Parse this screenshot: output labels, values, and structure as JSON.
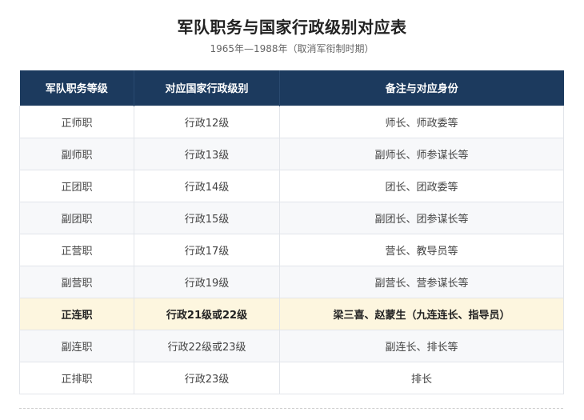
{
  "title": "军队职务与国家行政级别对应表",
  "subtitle": "1965年—1988年（取消军衔制时期）",
  "table": {
    "headers": [
      "军队职务等级",
      "对应国家行政级别",
      "备注与对应身份"
    ],
    "rows": [
      [
        "正师职",
        "行政12级",
        "师长、师政委等"
      ],
      [
        "副师职",
        "行政13级",
        "副师长、师参谋长等"
      ],
      [
        "正团职",
        "行政14级",
        "团长、团政委等"
      ],
      [
        "副团职",
        "行政15级",
        "副团长、团参谋长等"
      ],
      [
        "正营职",
        "行政17级",
        "营长、教导员等"
      ],
      [
        "副营职",
        "行政19级",
        "副营长、营参谋长等"
      ],
      [
        "正连职",
        "行政21级或22级",
        "梁三喜、赵蒙生（九连连长、指导员）"
      ],
      [
        "副连职",
        "行政22级或23级",
        "副连长、排长等"
      ],
      [
        "正排职",
        "行政23级",
        "排长"
      ]
    ],
    "highlighted_row_index": 6,
    "header_color": "#1c3a5e",
    "highlight_color": "#fdf6df"
  }
}
